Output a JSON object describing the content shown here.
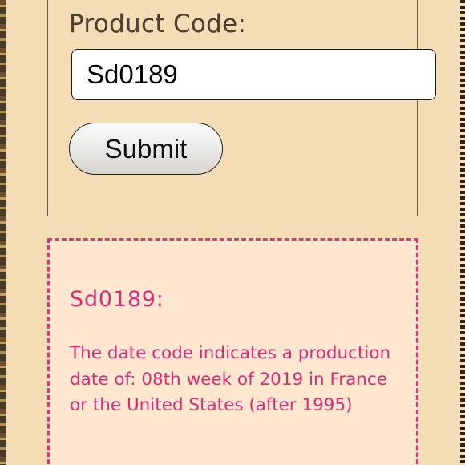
{
  "form": {
    "label": "Product Code:",
    "input_value": "Sd0189",
    "submit_label": "Submit"
  },
  "result": {
    "title": "Sd0189:",
    "message": "The date code indicates a production date of: 08th week of 2019 in France or the United States (after 1995)"
  },
  "colors": {
    "page_background": "#f4dcb4",
    "result_background": "#fde8cf",
    "accent": "#d92b7a",
    "label_text": "#4b4033"
  },
  "icons": {
    "left_border": "monogram-pattern",
    "right_border": "dotted-pattern"
  }
}
